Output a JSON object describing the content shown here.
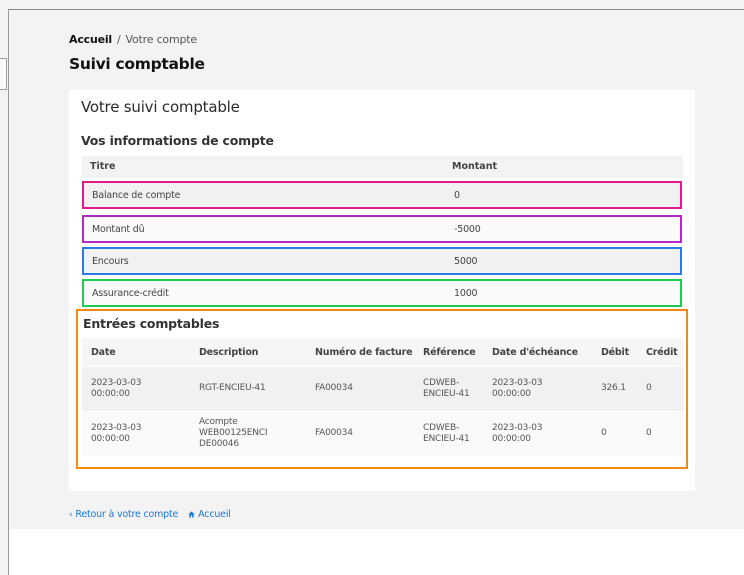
{
  "breadcrumb": {
    "home": "Accueil",
    "separator": "/",
    "current": "Votre compte"
  },
  "page": {
    "title": "Suivi comptable"
  },
  "card": {
    "title": "Votre suivi comptable"
  },
  "account_info": {
    "title": "Vos informations de compte",
    "headers": {
      "titre": "Titre",
      "montant": "Montant"
    },
    "rows": [
      {
        "titre": "Balance de compte",
        "montant": "0",
        "highlight": "#e21b8c"
      },
      {
        "titre": "Montant dû",
        "montant": "-5000",
        "highlight": "#b228c8"
      },
      {
        "titre": "Encours",
        "montant": "5000",
        "highlight": "#2a7ce3"
      },
      {
        "titre": "Assurance-crédit",
        "montant": "1000",
        "highlight": "#1fcb55"
      }
    ]
  },
  "entries": {
    "title": "Entrées comptables",
    "highlight": "#f28a12",
    "headers": {
      "date": "Date",
      "description": "Description",
      "numero": "Numéro de facture",
      "reference": "Référence",
      "echeance": "Date d'échéance",
      "debit": "Débit",
      "credit": "Crédit"
    },
    "rows": [
      {
        "date_l1": "2023-03-03",
        "date_l2": "00:00:00",
        "desc_l1": "RGT-ENCIEU-41",
        "numero": "FA00034",
        "ref_l1": "CDWEB-",
        "ref_l2": "ENCIEU-41",
        "ech_l1": "2023-03-03",
        "ech_l2": "00:00:00",
        "debit": "326.1",
        "credit": "0"
      },
      {
        "date_l1": "2023-03-03",
        "date_l2": "00:00:00",
        "desc_l1": "Acompte",
        "desc_l2": "WEB00125ENCI",
        "desc_l3": "DE00046",
        "numero": "FA00034",
        "ref_l1": "CDWEB-",
        "ref_l2": "ENCIEU-41",
        "ech_l1": "2023-03-03",
        "ech_l2": "00:00:00",
        "debit": "0",
        "credit": "0"
      }
    ]
  },
  "footer": {
    "back_label": "Retour à votre compte",
    "back_icon": "chevron-left-icon",
    "home_label": "Accueil",
    "home_icon": "home-icon",
    "link_color": "#1a78d6"
  }
}
